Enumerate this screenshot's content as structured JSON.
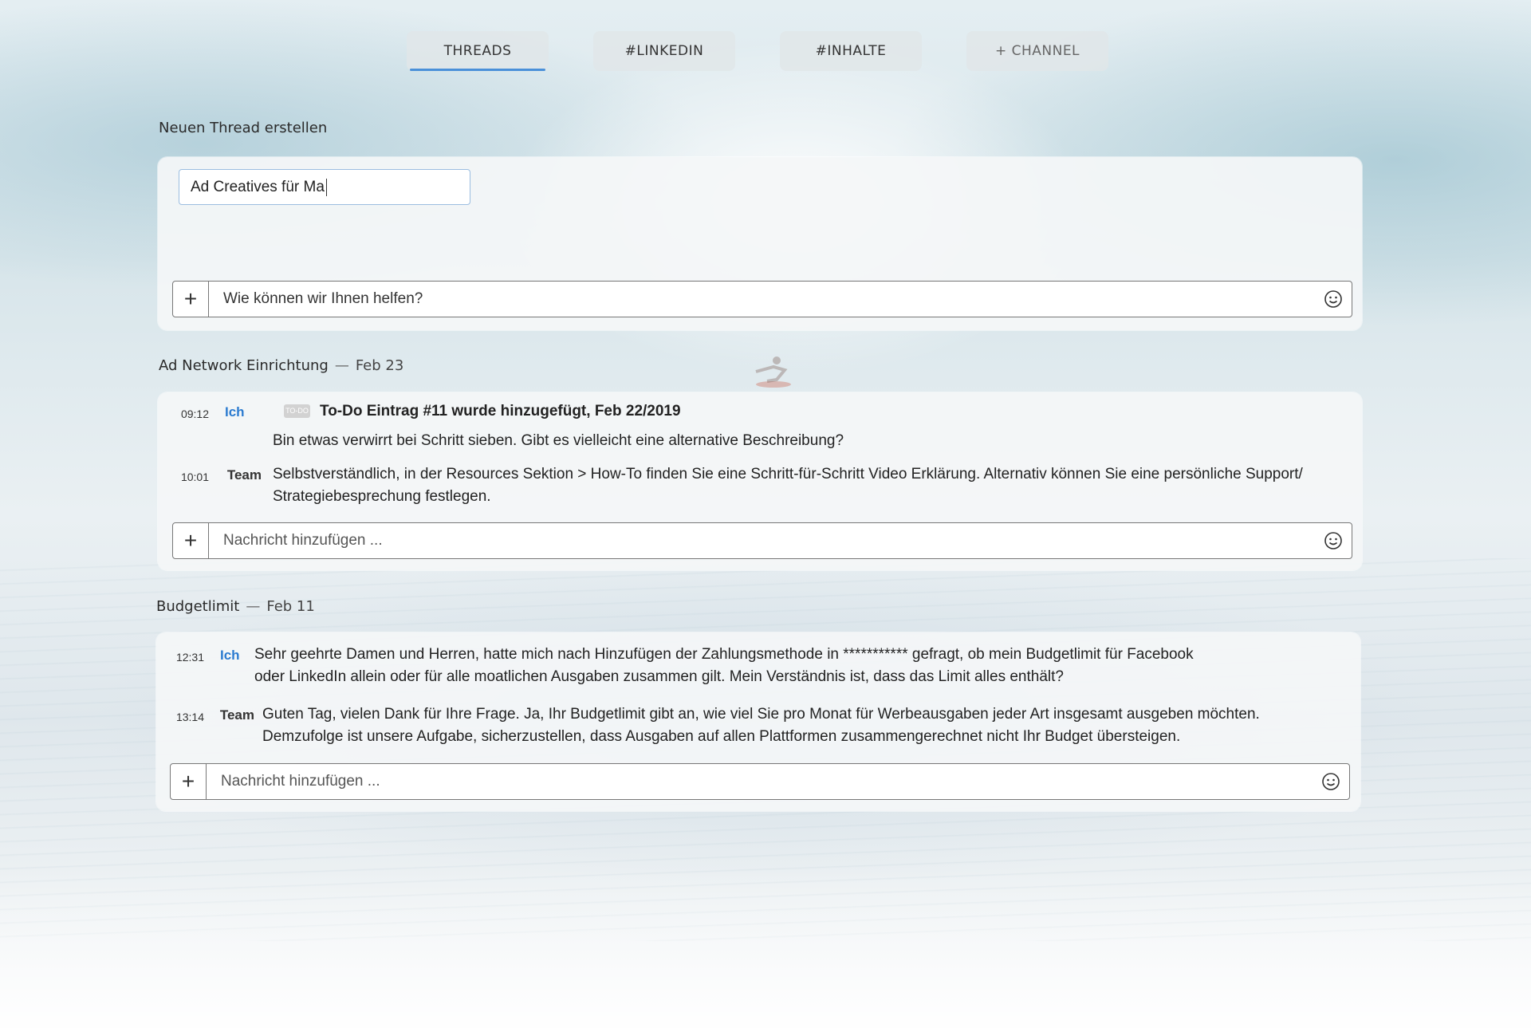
{
  "tabs": [
    {
      "label": "THREADS",
      "active": true
    },
    {
      "label": "#LINKEDIN",
      "active": false
    },
    {
      "label": "#INHALTE",
      "active": false
    },
    {
      "label": "+ CHANNEL",
      "active": false
    }
  ],
  "new_thread": {
    "heading": "Neuen Thread erstellen",
    "title_value": "Ad Creatives für Ma",
    "message_placeholder": "Wie können wir Ihnen helfen?"
  },
  "threads": [
    {
      "title": "Ad Network Einrichtung",
      "separator": "—",
      "date": "Feb 23",
      "todo": {
        "time": "09:12",
        "author": "Ich",
        "badge": "TO-DO",
        "text": "To-Do Eintrag #11 wurde hinzugefügt, Feb 22/2019"
      },
      "messages": [
        {
          "time": "",
          "author": "",
          "text": "Bin etwas verwirrt bei Schritt sieben. Gibt es vielleicht eine alternative Beschreibung?"
        },
        {
          "time": "10:01",
          "author": "Team",
          "text": "Selbstverständlich, in der Resources Sektion > How-To finden Sie eine Schritt-für-Schritt Video Erklärung. Alternativ können Sie eine persönliche Support/ Strategiebesprechung festlegen."
        }
      ],
      "composer_placeholder": "Nachricht hinzufügen ..."
    },
    {
      "title": "Budgetlimit",
      "separator": "—",
      "date": "Feb 11",
      "messages": [
        {
          "time": "12:31",
          "author": "Ich",
          "text": "Sehr geehrte Damen und Herren, hatte mich nach Hinzufügen der Zahlungsmethode in *********** gefragt, ob mein Budgetlimit für Facebook oder LinkedIn allein oder für alle moatlichen Ausgaben zusammen gilt. Mein Verständnis ist, dass das Limit alles enthält?"
        },
        {
          "time": "13:14",
          "author": "Team",
          "text": "Guten Tag, vielen Dank für Ihre Frage. Ja, Ihr Budgetlimit gibt an, wie viel Sie pro Monat für Werbeausgaben jeder Art insgesamt ausgeben möchten. Demzufolge ist unsere Aufgabe, sicherzustellen, dass Ausgaben auf allen Plattformen zusammengerechnet nicht Ihr Budget übersteigen."
        }
      ],
      "composer_placeholder": "Nachricht hinzufügen ..."
    }
  ],
  "icons": {
    "attach": "plus-icon",
    "emoji": "smiley-icon"
  },
  "colors": {
    "accent": "#4a90d9",
    "author_me": "#2b7bd0"
  }
}
